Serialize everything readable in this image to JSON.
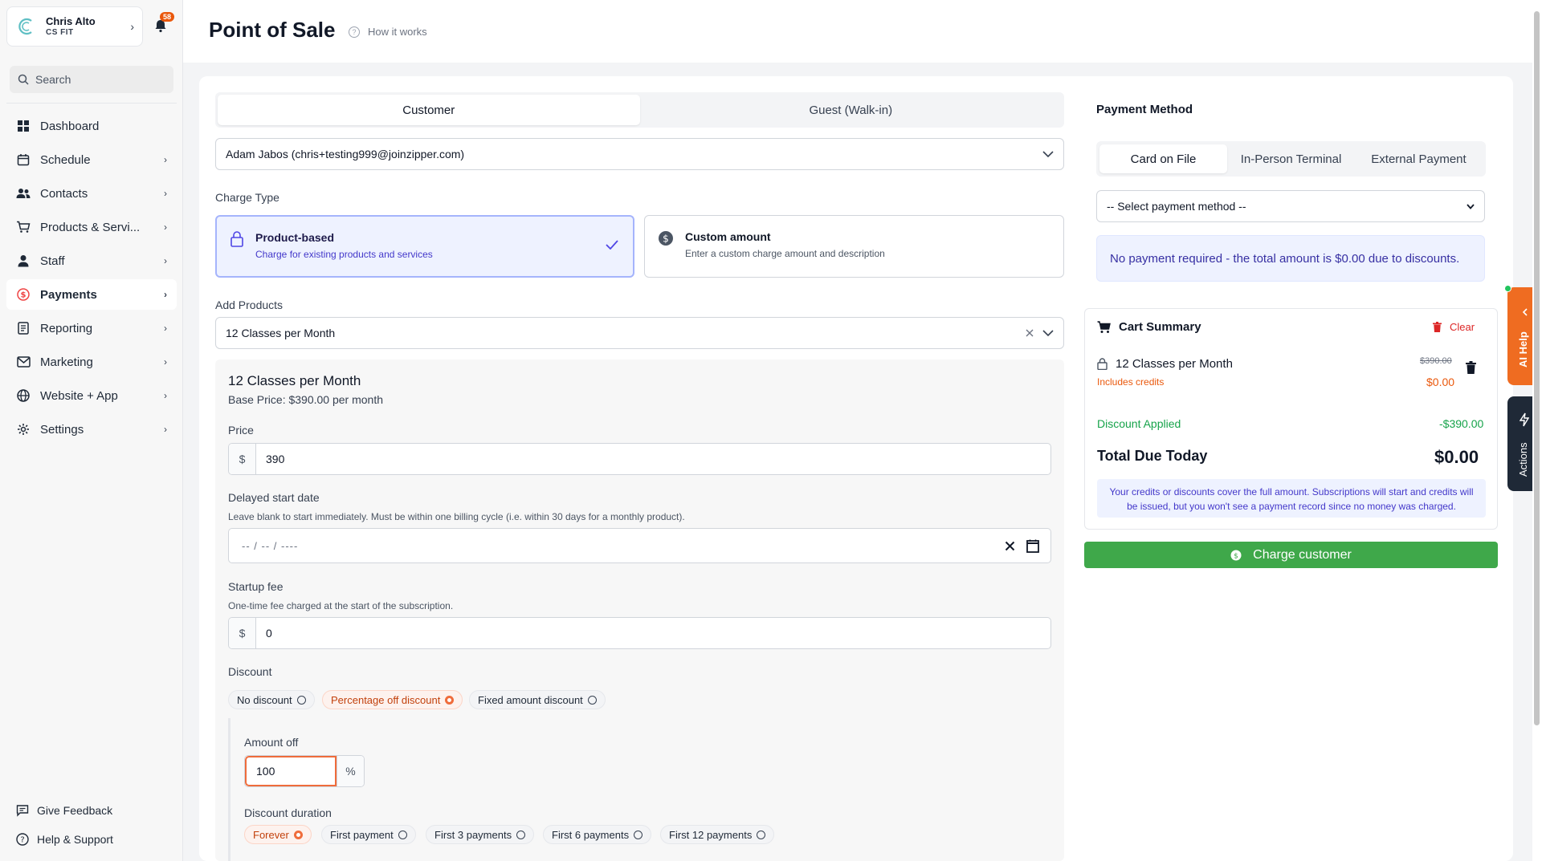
{
  "profile": {
    "name": "Chris Alto",
    "org": "CS FIT",
    "notifications": "58"
  },
  "search": {
    "placeholder": "Search"
  },
  "nav": [
    {
      "label": "Dashboard",
      "icon": "grid-icon",
      "chevron": false
    },
    {
      "label": "Schedule",
      "icon": "calendar-icon",
      "chevron": true
    },
    {
      "label": "Contacts",
      "icon": "people-icon",
      "chevron": true
    },
    {
      "label": "Products & Servi...",
      "icon": "cart-icon",
      "chevron": true
    },
    {
      "label": "Staff",
      "icon": "person-icon",
      "chevron": true
    },
    {
      "label": "Payments",
      "icon": "dollar-circle-icon",
      "chevron": true,
      "active": true
    },
    {
      "label": "Reporting",
      "icon": "report-icon",
      "chevron": true
    },
    {
      "label": "Marketing",
      "icon": "mail-icon",
      "chevron": true
    },
    {
      "label": "Website + App",
      "icon": "globe-icon",
      "chevron": true
    },
    {
      "label": "Settings",
      "icon": "gear-icon",
      "chevron": true
    }
  ],
  "sidebar_bottom": {
    "feedback": "Give Feedback",
    "help": "Help & Support"
  },
  "header": {
    "title": "Point of Sale",
    "how_it_works": "How it works"
  },
  "customer_tabs": {
    "customer": "Customer",
    "guest": "Guest (Walk-in)"
  },
  "customer_select": {
    "value": "Adam Jabos (chris+testing999@joinzipper.com)"
  },
  "charge_type": {
    "label": "Charge Type",
    "product_title": "Product-based",
    "product_desc": "Charge for existing products and services",
    "custom_title": "Custom amount",
    "custom_desc": "Enter a custom charge amount and description"
  },
  "add_products": {
    "label": "Add Products",
    "value": "12 Classes per Month"
  },
  "product": {
    "title": "12 Classes per Month",
    "base_price": "Base Price: $390.00 per month",
    "price_label": "Price",
    "currency": "$",
    "price_value": "390",
    "delayed_label": "Delayed start date",
    "delayed_help": "Leave blank to start immediately. Must be within one billing cycle (i.e. within 30 days for a monthly product).",
    "date_placeholder": "-- / -- / ----",
    "startup_label": "Startup fee",
    "startup_help": "One-time fee charged at the start of the subscription.",
    "startup_value": "0",
    "discount_label": "Discount",
    "discount_options": [
      "No discount",
      "Percentage off discount",
      "Fixed amount discount"
    ],
    "amount_off_label": "Amount off",
    "amount_off_value": "100",
    "percent": "%",
    "duration_label": "Discount duration",
    "duration_options": [
      "Forever",
      "First payment",
      "First 3 payments",
      "First 6 payments",
      "First 12 payments"
    ]
  },
  "payment": {
    "title": "Payment Method",
    "tabs": [
      "Card on File",
      "In-Person Terminal",
      "External Payment"
    ],
    "select_value": "-- Select payment method --",
    "info": "No payment required - the total amount is $0.00 due to discounts."
  },
  "cart": {
    "title": "Cart Summary",
    "clear": "Clear",
    "item_name": "12 Classes per Month",
    "item_note": "Includes credits",
    "item_old_price": "$390.00",
    "item_new_price": "$0.00",
    "discount_label": "Discount Applied",
    "discount_value": "-$390.00",
    "total_label": "Total Due Today",
    "total_value": "$0.00",
    "note": "Your credits or discounts cover the full amount. Subscriptions will start and credits will be issued, but you won't see a payment record since no money was charged."
  },
  "charge_button": "Charge customer",
  "floating": {
    "ai_help": "AI Help",
    "actions": "Actions"
  }
}
